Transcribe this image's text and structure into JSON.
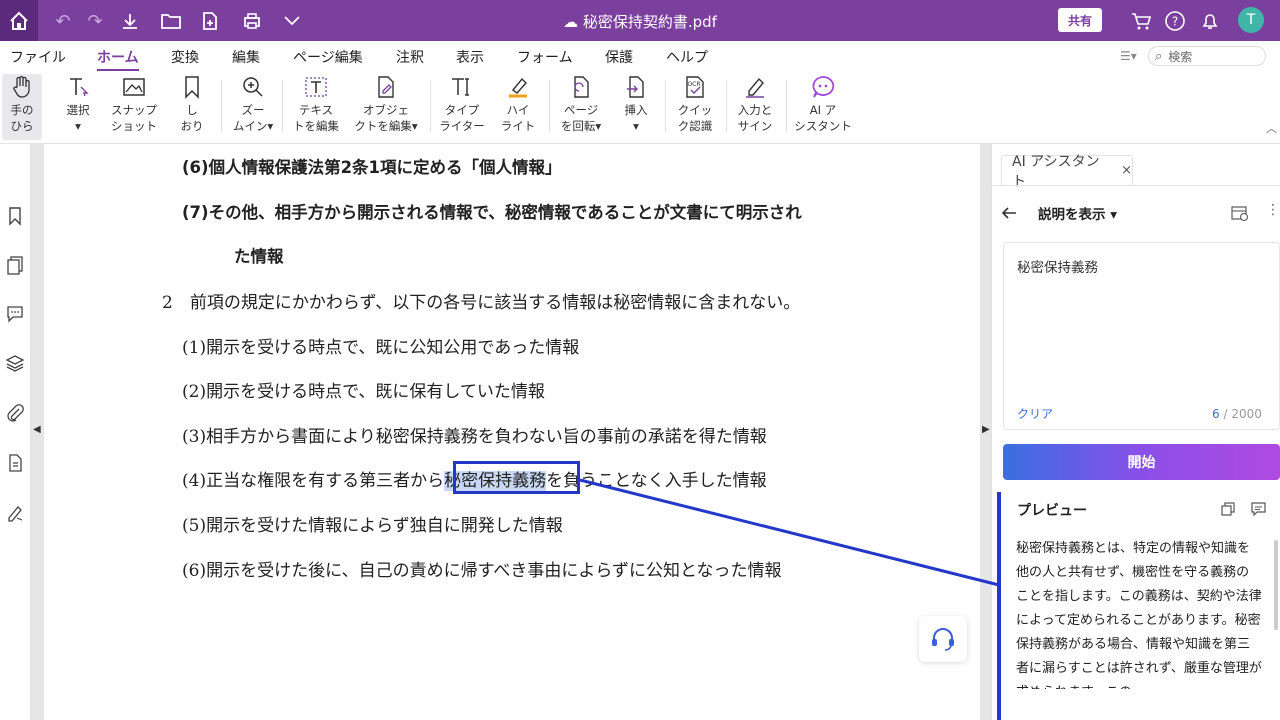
{
  "titlebar": {
    "doc_title": "秘密保持契約書.pdf",
    "share_label": "共有",
    "avatar_letter": "T"
  },
  "menu": {
    "items": [
      "ファイル",
      "ホーム",
      "変換",
      "編集",
      "ページ編集",
      "注釈",
      "表示",
      "フォーム",
      "保護",
      "ヘルプ"
    ],
    "active": "ホーム",
    "search_placeholder": "検索"
  },
  "ribbon": {
    "hand": [
      "手の",
      "ひら"
    ],
    "select": [
      "選択",
      "▾"
    ],
    "snapshot": [
      "スナップ",
      "ショット"
    ],
    "bookmark": [
      "し",
      "おり"
    ],
    "zoom": [
      "ズー",
      "ムイン▾"
    ],
    "edit_text": [
      "テキス",
      "トを編集"
    ],
    "edit_object": [
      "オブジェ",
      "クトを編集▾"
    ],
    "typewriter": [
      "タイプ",
      "ライター"
    ],
    "highlight": [
      "ハイ",
      "ライト"
    ],
    "rotate": [
      "ページ",
      "を回転▾"
    ],
    "insert": [
      "挿入",
      "▾"
    ],
    "ocr": [
      "クイッ",
      "ク認識"
    ],
    "sign": [
      "入力と",
      "サイン"
    ],
    "ai": [
      "AI ア",
      "シスタント"
    ]
  },
  "document": {
    "lines": [
      "(6)個人情報保護法第2条1項に定める「個人情報」",
      "(7)その他、相手方から開示される情報で、秘密情報であることが文書にて明示され",
      "た情報",
      "2　前項の規定にかかわらず、以下の各号に該当する情報は秘密情報に含まれない。",
      "(1)開示を受ける時点で、既に公知公用であった情報",
      "(2)開示を受ける時点で、既に保有していた情報",
      "(3)相手方から書面により秘密保持義務を負わない旨の事前の承諾を得た情報",
      "(4)正当な権限を有する第三者から",
      "秘密保持義務",
      "を負うことなく入手した情報",
      "(5)開示を受けた情報によらず独自に開発した情報",
      "(6)開示を受けた後に、自己の責めに帰すべき事由によらずに公知となった情報"
    ]
  },
  "ai_panel": {
    "tab_label": "AI アシスタント",
    "tab_close": "×",
    "mode_label": "説明を表示 ▾",
    "input_text": "秘密保持義務",
    "clear_label": "クリア",
    "char_current": "6",
    "char_max": " / 2000",
    "start_label": "開始",
    "preview_title": "プレビュー",
    "preview_text": "秘密保持義務とは、特定の情報や知識を他の人と共有せず、機密性を守る義務のことを指します。この義務は、契約や法律によって定められることがあります。秘密保持義務がある場合、情報や知識を第三者に漏らすことは許されず、厳重な管理が求められます。この"
  },
  "colors": {
    "titlebar": "#7b3f9e",
    "accent": "#7b3f9e",
    "selection_box": "#2437c9",
    "link": "#3a6fd8"
  }
}
